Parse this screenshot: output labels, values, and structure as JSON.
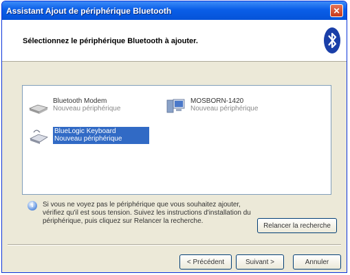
{
  "window": {
    "title": "Assistant Ajout de périphérique Bluetooth",
    "close_glyph": "✕"
  },
  "header": {
    "title": "Sélectionnez le périphérique Bluetooth à ajouter.",
    "logo_icon": "bluetooth-icon"
  },
  "devices": [
    {
      "name": "Bluetooth Modem",
      "status": "Nouveau périphérique",
      "icon": "modem-icon",
      "selected": false
    },
    {
      "name": "MOSBORN-1420",
      "status": "Nouveau périphérique",
      "icon": "computer-icon",
      "selected": false
    },
    {
      "name": "BlueLogic Keyboard",
      "status": "Nouveau périphérique",
      "icon": "keyboard-icon",
      "selected": true
    }
  ],
  "info": {
    "icon": "info-icon",
    "text": "Si vous ne voyez pas le périphérique que vous souhaitez ajouter, vérifiez qu'il est sous tension. Suivez les instructions d'installation du périphérique, puis cliquez sur Relancer la recherche."
  },
  "buttons": {
    "rescan": "Relancer la recherche",
    "back": "< Précédent",
    "next": "Suivant >",
    "cancel": "Annuler"
  },
  "colors": {
    "titlebar": "#0a5ee8",
    "selection": "#316ac5",
    "window_bg": "#ece9d8"
  }
}
